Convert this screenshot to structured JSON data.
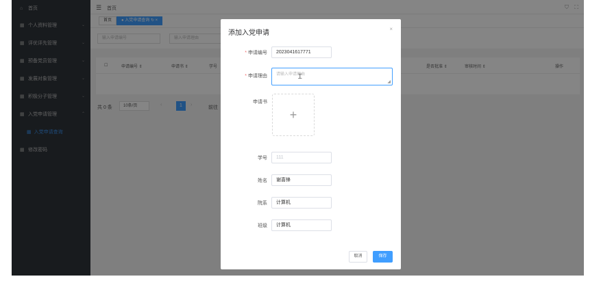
{
  "sidebar": {
    "home": "首页",
    "items": [
      {
        "label": "个人资料管理",
        "chev": "⌄"
      },
      {
        "label": "评优评先管理",
        "chev": "⌄"
      },
      {
        "label": "预备党员管理",
        "chev": "⌄"
      },
      {
        "label": "发展对象管理",
        "chev": "⌄"
      },
      {
        "label": "积极分子管理",
        "chev": "⌄"
      },
      {
        "label": "入党申请管理",
        "chev": "⌃"
      }
    ],
    "sub_item": "入党申请查询",
    "last": "修改密码"
  },
  "topbar": {
    "menu_icon": "☰",
    "breadcrumb": "首页",
    "right1": "⛉",
    "right2": "⛶"
  },
  "tags": {
    "home": "首页",
    "active": "● 入党申请查询 ↻ ×"
  },
  "search": {
    "input1_placeholder": "输入申请编号",
    "input2_placeholder": "输入申请理由"
  },
  "table": {
    "headers": [
      "申请编号 ⇕",
      "申请书 ⇕",
      "学号",
      "是否批准 ⇕",
      "审核时间 ⇕",
      "操作"
    ]
  },
  "pager": {
    "total": "共 0 条",
    "size": "10条/页",
    "prev": "‹",
    "page": "1",
    "next": "›",
    "goto": "前往"
  },
  "dialog": {
    "title": "添加入党申请",
    "close": "×",
    "fields": {
      "code_label": "申请编号",
      "code_value": "2023041617771",
      "reason_label": "申请理由",
      "reason_placeholder": "请输入申请理由",
      "letter_label": "申请书",
      "upload_plus": "+",
      "sid_label": "学号",
      "sid_value": "111",
      "name_label": "姓名",
      "name_value": "谢喜锋",
      "dept_label": "院系",
      "dept_value": "计算机",
      "class_label": "班级",
      "class_value": "计算机"
    },
    "cancel": "取消",
    "save": "保存"
  }
}
